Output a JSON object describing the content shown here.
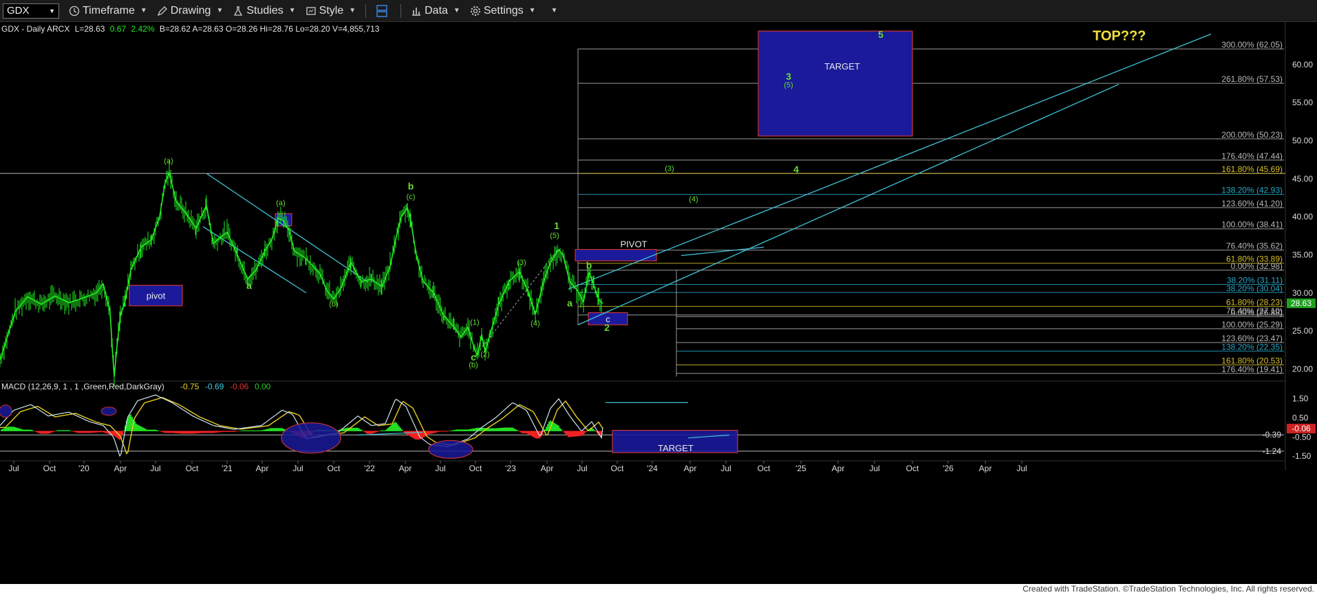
{
  "toolbar": {
    "symbol": "GDX",
    "timeframe": "Timeframe",
    "drawing": "Drawing",
    "studies": "Studies",
    "style": "Style",
    "data": "Data",
    "settings": "Settings"
  },
  "header": {
    "title": "GDX - Daily  ARCX",
    "last": "L=28.63",
    "change": "0.67",
    "pct": "2.42%",
    "rest": "B=28.62  A=28.63  O=28.26  Hi=28.76  Lo=28.20  V=4,855,713"
  },
  "footer": "Created with TradeStation. ©TradeStation Technologies, Inc. All rights reserved.",
  "colors": {
    "price": "#22ee22",
    "channel": "#40c4d8",
    "box_fill": "#1a1a9a",
    "box_border": "#cc3333",
    "fib_line": "#b0b0b0",
    "wave_label": "#66dd33",
    "top_text": "#f2e23a",
    "macd_up": "#22dd22",
    "macd_down": "#ee2222"
  },
  "chart_data": [
    {
      "type": "line",
      "ylim": [
        18.5,
        64.5
      ],
      "y_ticks": [
        "60.00",
        "55.00",
        "50.00",
        "45.00",
        "40.00",
        "35.00",
        "30.00",
        "25.00",
        "20.00"
      ],
      "x_ticks": [
        "Jul",
        "Oct",
        "'20",
        "Apr",
        "Jul",
        "Oct",
        "'21",
        "Apr",
        "Jul",
        "Oct",
        "'22",
        "Apr",
        "Jul",
        "Oct",
        "'23",
        "Apr",
        "Jul",
        "Oct",
        "'24",
        "Apr",
        "Jul",
        "Oct",
        "'25",
        "Apr",
        "Jul",
        "Oct",
        "'26",
        "Apr",
        "Jul"
      ],
      "last_price": "28.63",
      "series": [
        {
          "points": [
            [
              0,
              21.2
            ],
            [
              10,
              24
            ],
            [
              22,
              27.5
            ],
            [
              40,
              29.5
            ],
            [
              60,
              28.5
            ],
            [
              80,
              29.6
            ],
            [
              100,
              28.7
            ],
            [
              120,
              29.3
            ],
            [
              140,
              30.0
            ],
            [
              150,
              31.2
            ],
            [
              160,
              27.5
            ],
            [
              163,
              23
            ],
            [
              166,
              19.0
            ],
            [
              170,
              23
            ],
            [
              175,
              27
            ],
            [
              182,
              29
            ],
            [
              190,
              33
            ],
            [
              205,
              36
            ],
            [
              220,
              37
            ],
            [
              232,
              40
            ],
            [
              240,
              44.5
            ],
            [
              246,
              45.8
            ],
            [
              256,
              42
            ],
            [
              270,
              40.5
            ],
            [
              285,
              38.5
            ],
            [
              300,
              41.5
            ],
            [
              310,
              36.5
            ],
            [
              330,
              38.0
            ],
            [
              345,
              35
            ],
            [
              360,
              31.8
            ],
            [
              372,
              33
            ],
            [
              385,
              35.5
            ],
            [
              395,
              37
            ],
            [
              404,
              39.8
            ],
            [
              412,
              39.5
            ],
            [
              420,
              38.2
            ],
            [
              428,
              35.5
            ],
            [
              445,
              34.5
            ],
            [
              465,
              32.5
            ],
            [
              475,
              30.3
            ],
            [
              485,
              29.2
            ],
            [
              495,
              30.5
            ],
            [
              510,
              34
            ],
            [
              525,
              31.5
            ],
            [
              540,
              31.8
            ],
            [
              555,
              30.8
            ],
            [
              567,
              33.5
            ],
            [
              575,
              37
            ],
            [
              583,
              40
            ],
            [
              592,
              41.2
            ],
            [
              597,
              39.5
            ],
            [
              605,
              35
            ],
            [
              615,
              31.5
            ],
            [
              630,
              30
            ],
            [
              645,
              27
            ],
            [
              660,
              25.5
            ],
            [
              670,
              24.2
            ],
            [
              680,
              25.5
            ],
            [
              690,
              22.5
            ],
            [
              694,
              21.8
            ],
            [
              700,
              24.5
            ],
            [
              705,
              22.3
            ],
            [
              712,
              24.5
            ],
            [
              725,
              28.5
            ],
            [
              740,
              31.5
            ],
            [
              755,
              32.8
            ],
            [
              768,
              30
            ],
            [
              778,
              27.2
            ],
            [
              790,
              31.5
            ],
            [
              800,
              34
            ],
            [
              812,
              35.7
            ],
            [
              818,
              35
            ],
            [
              828,
              31.5
            ],
            [
              840,
              30.2
            ],
            [
              848,
              28.8
            ],
            [
              856,
              32.7
            ],
            [
              863,
              31
            ],
            [
              870,
              29.1
            ],
            [
              876,
              28.6
            ]
          ]
        }
      ],
      "fib_levels": [
        {
          "label": "300.00% (62.05)",
          "value": 62.05
        },
        {
          "label": "261.80% (57.53)",
          "value": 57.53
        },
        {
          "label": "200.00% (50.23)",
          "value": 50.23
        },
        {
          "label": "176.40% (47.44)",
          "value": 47.44
        },
        {
          "label": "161.80% (45.69)",
          "value": 45.69,
          "extra": "45.69"
        },
        {
          "label": "138.20% (42.93)",
          "value": 42.93
        },
        {
          "label": "123.60% (41.20)",
          "value": 41.2
        },
        {
          "label": "100.00% (38.41)",
          "value": 38.41
        },
        {
          "label": "76.40% (35.62)",
          "value": 35.62
        },
        {
          "label": "61.80% (33.89)",
          "value": 33.89
        },
        {
          "label": "0.00% (32.98)",
          "value": 32.98
        },
        {
          "label": "38.20% (31.11)",
          "value": 31.11
        },
        {
          "label": "38.20% (30.04)",
          "value": 30.04
        },
        {
          "label": "61.80% (28.23)",
          "value": 28.23
        },
        {
          "label": "76.40% (27.10)",
          "value": 27.1
        },
        {
          "label": "0.00% (26.88)",
          "value": 26.88
        },
        {
          "label": "100.00% (25.29)",
          "value": 25.29
        },
        {
          "label": "123.60% (23.47)",
          "value": 23.47
        },
        {
          "label": "138.20% (22.35)",
          "value": 22.35
        },
        {
          "label": "161.80% (20.53)",
          "value": 20.53
        },
        {
          "label": "176.40% (19.41)",
          "value": 19.41
        }
      ],
      "annotations": [
        {
          "text": "(a)",
          "x": 245,
          "y": 47.0
        },
        {
          "text": "a",
          "x": 362,
          "y": 30.5
        },
        {
          "text": "(a)",
          "x": 408,
          "y": 41.5
        },
        {
          "text": "(b)",
          "x": 485,
          "y": 28.2
        },
        {
          "text": "b",
          "x": 597,
          "y": 43.6
        },
        {
          "text": "(c)",
          "x": 597,
          "y": 42.3
        },
        {
          "text": "c",
          "x": 688,
          "y": 21.1
        },
        {
          "text": "(b)",
          "x": 688,
          "y": 20.2
        },
        {
          "text": "(1)",
          "x": 690,
          "y": 25.8
        },
        {
          "text": "(2)",
          "x": 705,
          "y": 21.6
        },
        {
          "text": "(3)",
          "x": 758,
          "y": 33.7
        },
        {
          "text": "(4)",
          "x": 778,
          "y": 25.7
        },
        {
          "text": "(5)",
          "x": 806,
          "y": 37.2
        },
        {
          "text": "1",
          "x": 809,
          "y": 38.4
        },
        {
          "text": "a",
          "x": 828,
          "y": 28.2
        },
        {
          "text": "b",
          "x": 856,
          "y": 33.2
        },
        {
          "text": "2",
          "x": 882,
          "y": 25.0
        },
        {
          "text": "(3)",
          "x": 973,
          "y": 46.0
        },
        {
          "text": "(4)",
          "x": 1008,
          "y": 42.0
        },
        {
          "text": "4",
          "x": 1157,
          "y": 45.8
        },
        {
          "text": "3",
          "x": 1146,
          "y": 58.0
        },
        {
          "text": "(5)",
          "x": 1146,
          "y": 57.0
        },
        {
          "text": "5",
          "x": 1280,
          "y": 63.5
        }
      ],
      "boxes": [
        {
          "label": "pivot",
          "x1": 188,
          "x2": 265,
          "y1": 28.3,
          "y2": 31.0
        },
        {
          "label": "",
          "x1": 400,
          "x2": 424,
          "y1": 38.8,
          "y2": 40.4
        },
        {
          "label": "PIVOT",
          "x1": 836,
          "x2": 954,
          "y1": 34.2,
          "y2": 35.7
        },
        {
          "label": "c",
          "x1": 855,
          "x2": 912,
          "y1": 25.8,
          "y2": 27.4
        },
        {
          "label": "TARGET",
          "x1": 1102,
          "x2": 1326,
          "y1": 50.6,
          "y2": 64.4
        }
      ],
      "top_label": "TOP???"
    },
    {
      "type": "line",
      "title": "MACD (12,26,9, 1 , 1 ,Green,Red,DarkGray)",
      "values_text": [
        "-0.75",
        "-0.69",
        "-0.06",
        "0.00"
      ],
      "ylim": [
        -1.75,
        1.85
      ],
      "y_ticks": [
        "1.50",
        "0.50",
        "-0.50",
        "-1.50"
      ],
      "levels": [
        "-0.39",
        "-1.24"
      ],
      "last_value": "-0.06",
      "target_label": "TARGET"
    }
  ]
}
